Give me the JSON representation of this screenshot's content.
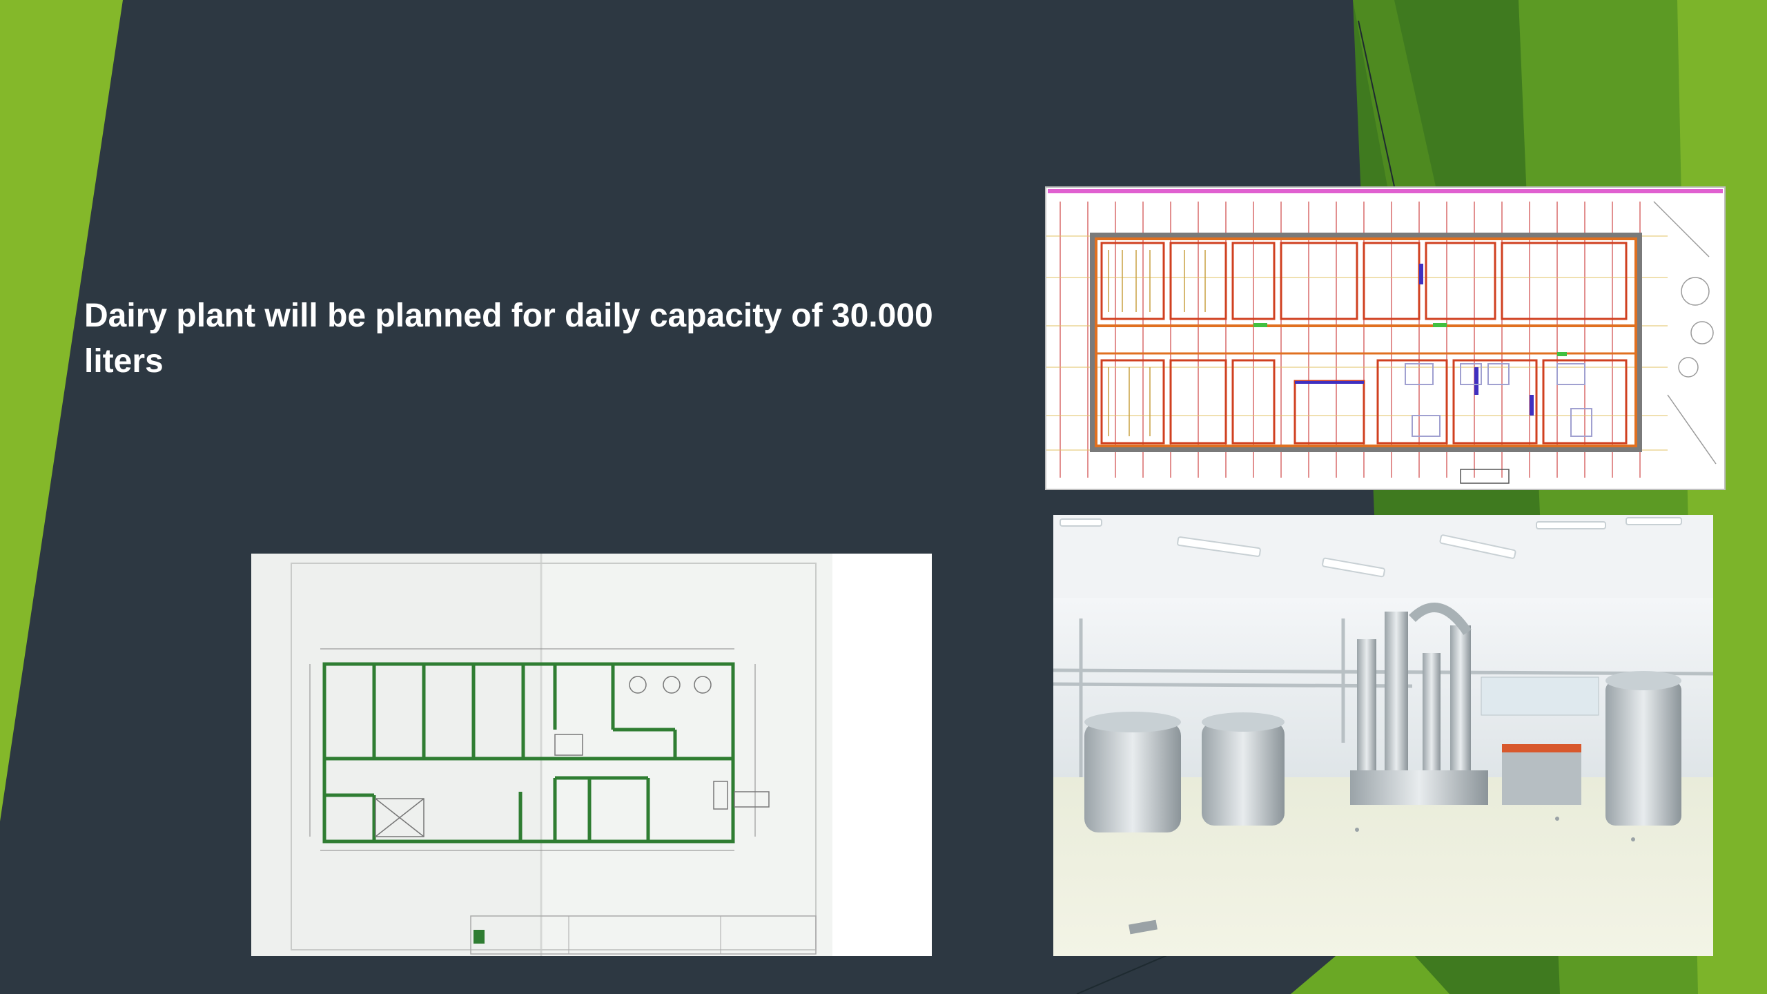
{
  "slide": {
    "text_line_1": "Dairy plant will be planned for  daily capacity of 30.000",
    "text_line_2": "liters"
  },
  "images": {
    "floorplan_color": "colored architectural floor plan",
    "floorplan_green": "scanned floor plan with green walls",
    "plant_photo": "photo of dairy processing equipment"
  },
  "colors": {
    "background": "#2d3842",
    "accent_light_green": "#86b92c",
    "accent_dark_green": "#3f7a1f",
    "text": "#ffffff"
  }
}
